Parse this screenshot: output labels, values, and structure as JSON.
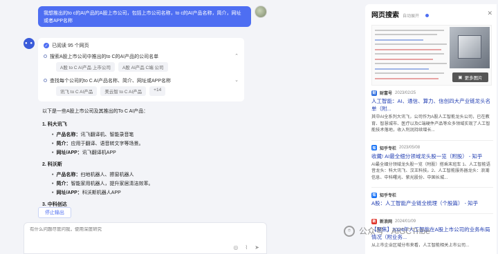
{
  "user_message": "我想推出的to c的AI产品的A股上市公司，包括上市公司名称，to c的AI产品名称，简介，网址或者APP名称",
  "reading": {
    "title": "已阅读 95 个网页",
    "steps": [
      {
        "text": "搜索A股上市公司中推出的to C的AI产品的公司名单",
        "tags": [
          "A股 to C AI产品 上市公司",
          "A股 AI产品 C端 公司"
        ]
      },
      {
        "text": "查找每个公司的to C AI产品名称、简介、网址或APP名称",
        "tags": [
          "讯飞 to C AI产品",
          "美云智 to C AI产品",
          "+14"
        ]
      }
    ]
  },
  "answer": {
    "intro": "以下是一些A股上市公司及其推出的To C AI产品：",
    "companies": [
      {
        "heading": "1. 科大讯飞",
        "items": [
          {
            "label": "产品名称：",
            "value": "讯飞翻译机、智能录音笔"
          },
          {
            "label": "简介：",
            "value": "应用于翻译、语音转文字等场景。"
          },
          {
            "label": "网址/APP：",
            "value": "讯飞翻译机APP"
          }
        ]
      },
      {
        "heading": "2. 科沃斯",
        "items": [
          {
            "label": "产品名称：",
            "value": "扫地机器人、擦窗机器人"
          },
          {
            "label": "简介：",
            "value": "智能家用机器人，提升家居清洁效率。"
          },
          {
            "label": "网址/APP：",
            "value": "科沃斯机器人APP"
          }
        ]
      }
    ],
    "partial_heading": "3. 中科创达"
  },
  "stop_button": "停止输出",
  "input_placeholder": "有什么问题尽管问我，使用深度研究",
  "panel": {
    "title": "网页搜索",
    "subtitle": "自动展开",
    "more_images": "更多图片",
    "results": [
      {
        "source": "财富号",
        "date": "2023/02/25",
        "logo_color": "#2f6fe0",
        "logo_text": "财",
        "title": "人工智能：AI、通信、算力、信创四大产业链龙头名单（附...",
        "snippet": "其中AI全系列大讯飞，公司作为A股人工智能龙头公司，已在教育、智慧城市、医疗以及C端硬件产品等众多领域实现了人工智能技术落地，收入利润持续增长..."
      },
      {
        "source": "知乎专栏",
        "date": "2023/05/08",
        "logo_color": "#1772f6",
        "logo_text": "知",
        "title": "收藏! AI最全细分领域龙头股一览（附股） - 知乎",
        "snippet": "AI最全细分领域龙头股一览（附股）搭乘末班车 1、人工智能语音龙头：科大讯飞、汉王科技。2、人工智能服务器龙头：浪潮信息、中科曙光、紫光股份、中国长城..."
      },
      {
        "source": "知乎专栏",
        "date": "",
        "logo_color": "#1772f6",
        "logo_text": "知",
        "title": "A股：人工智能产业链全梳理（个股篇） - 知乎",
        "snippet": ""
      },
      {
        "source": "新浪网",
        "date": "2024/01/09",
        "logo_color": "#e0352b",
        "logo_text": "新",
        "title": "【聚焦】2024年人工智能在A股上市公司的业务布局情况（附业务...",
        "snippet": "从上市企业区域分布来看，人工智能相关上市公司..."
      }
    ]
  },
  "watermark": "公众号 · AIGCTribe"
}
